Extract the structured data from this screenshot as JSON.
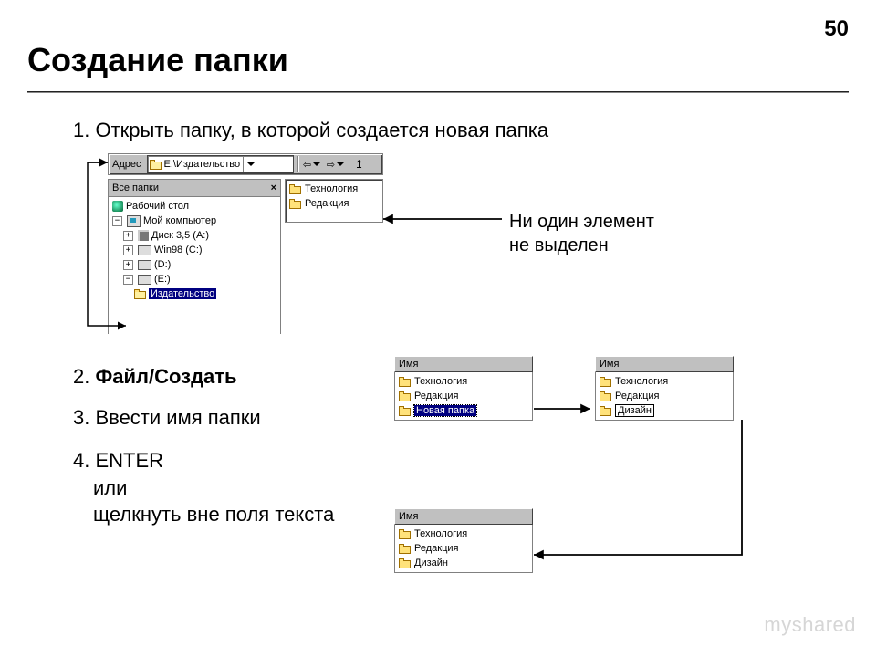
{
  "page_number": "50",
  "title": "Создание папки",
  "steps": {
    "s1": "1. Открыть папку, в которой создается новая папка",
    "s2_prefix": "2. ",
    "s2_bold": "Файл/Создать",
    "s3": "3. Ввести имя папки",
    "s4_l1": "4. ENTER",
    "s4_l2": "или",
    "s4_l3": "щелкнуть вне поля текста"
  },
  "annotation": {
    "l1": "Ни один элемент",
    "l2": "не выделен"
  },
  "address_bar": {
    "label": "Адрес",
    "value": "E:\\Издательство"
  },
  "tree": {
    "header": "Все папки",
    "close": "×",
    "items": [
      {
        "label": "Рабочий стол"
      },
      {
        "label": "Мой компьютер"
      },
      {
        "label": "Диск 3,5 (A:)"
      },
      {
        "label": "Win98 (C:)"
      },
      {
        "label": "(D:)"
      },
      {
        "label": "(E:)"
      },
      {
        "label": "Издательство"
      }
    ]
  },
  "right_list": {
    "items": [
      {
        "label": "Технология"
      },
      {
        "label": "Редакция"
      }
    ]
  },
  "column_header": "Имя",
  "mini_a": {
    "items": [
      {
        "label": "Технология"
      },
      {
        "label": "Редакция"
      },
      {
        "label": "Новая папка"
      }
    ]
  },
  "mini_b": {
    "items": [
      {
        "label": "Технология"
      },
      {
        "label": "Редакция"
      },
      {
        "label": "Дизайн"
      }
    ]
  },
  "mini_c": {
    "items": [
      {
        "label": "Технология"
      },
      {
        "label": "Редакция"
      },
      {
        "label": "Дизайн"
      }
    ]
  },
  "watermark": "myshared"
}
